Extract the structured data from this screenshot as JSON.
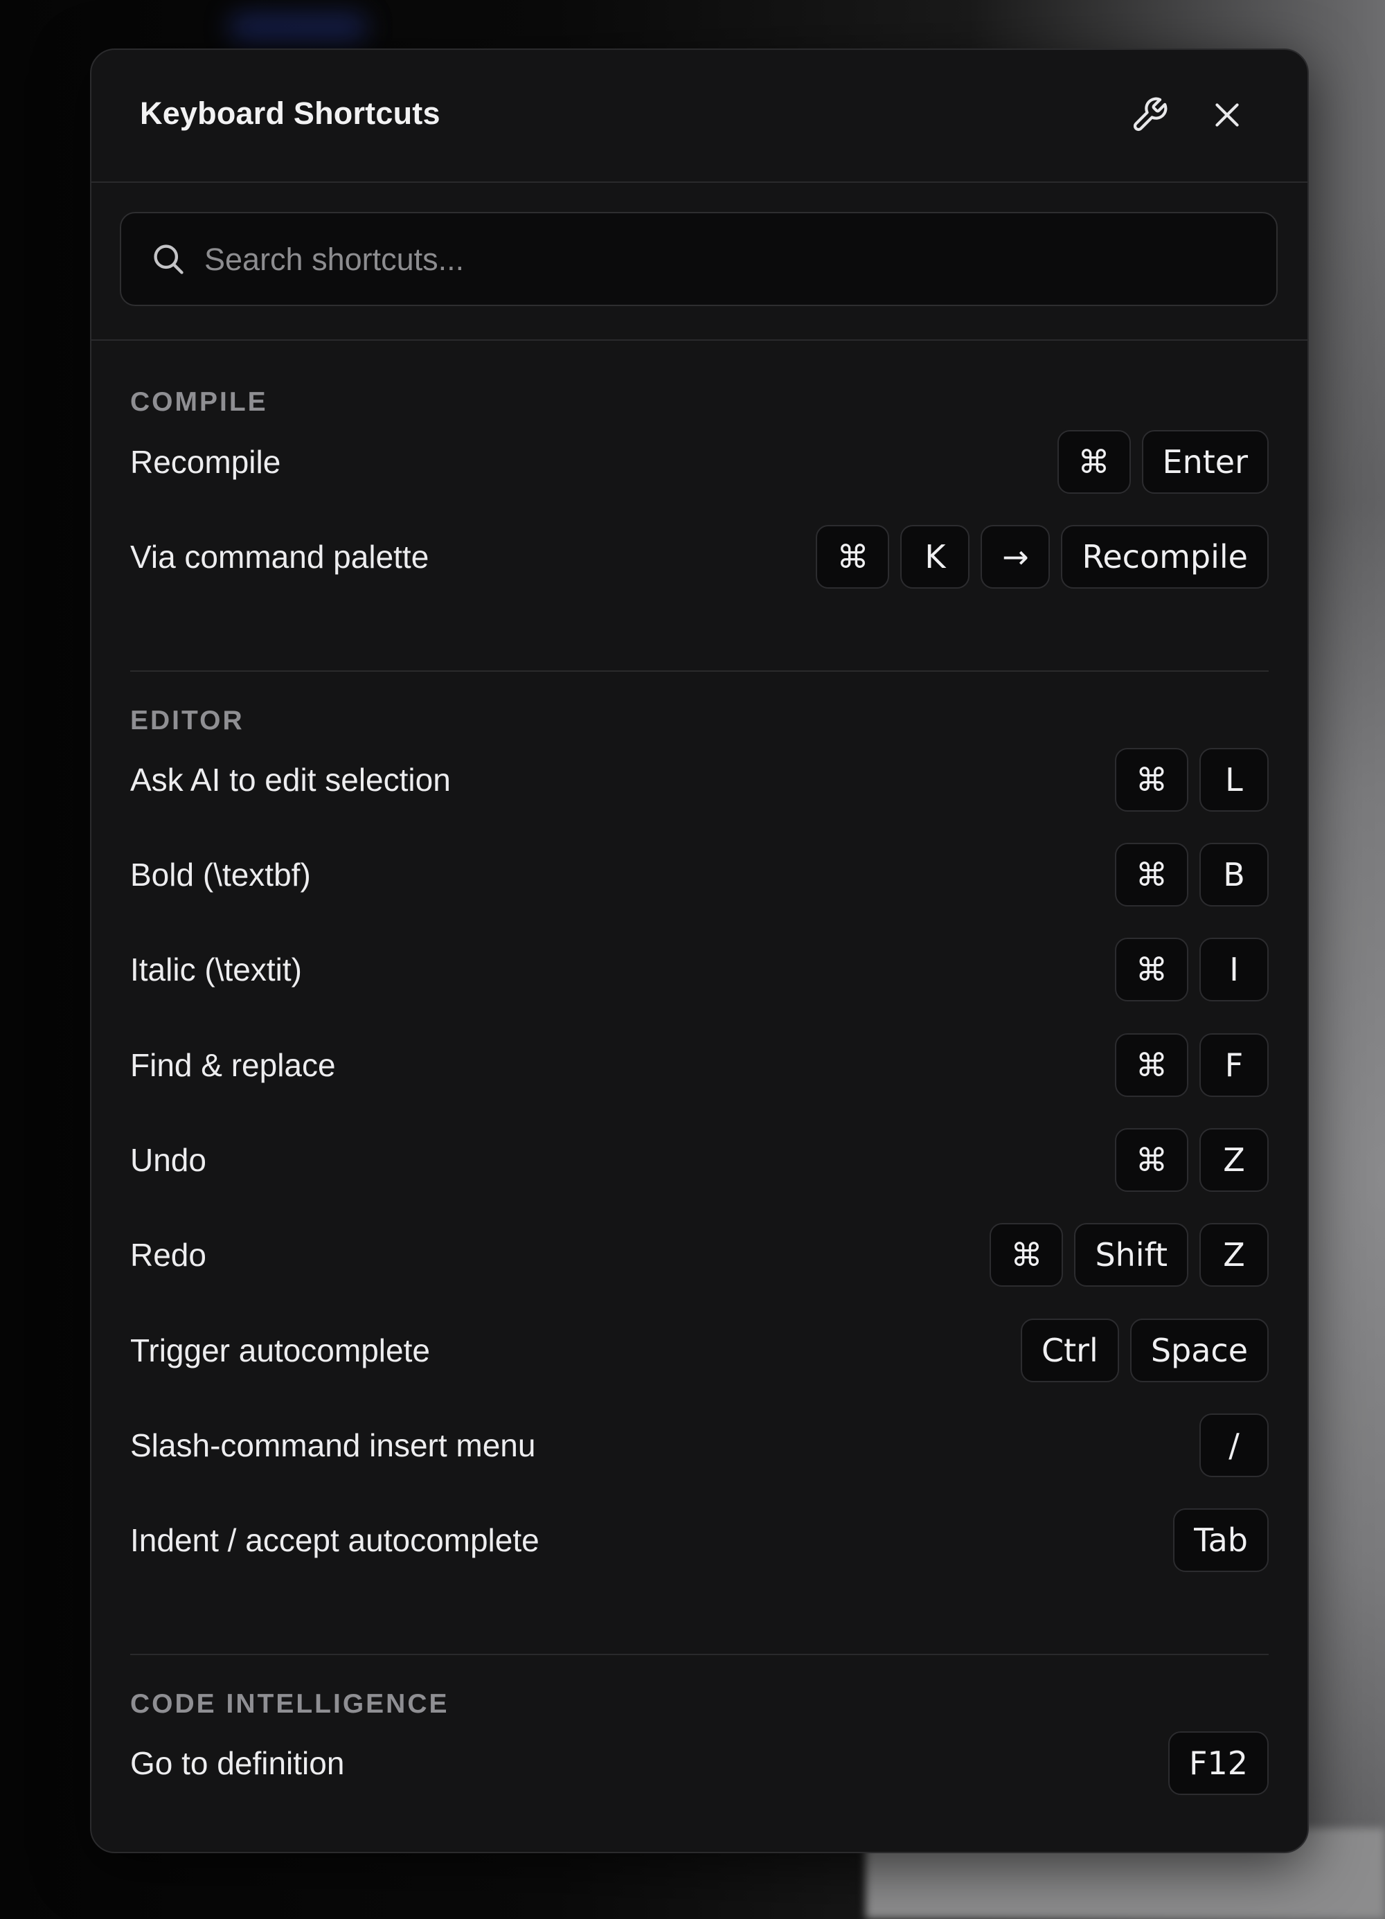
{
  "dialog": {
    "title": "Keyboard Shortcuts",
    "wrench_icon": "wrench-icon",
    "close_icon": "close-icon"
  },
  "search": {
    "placeholder": "Search shortcuts...",
    "value": "",
    "icon": "search-icon"
  },
  "sections": [
    {
      "title": "COMPILE",
      "items": [
        {
          "label": "Recompile",
          "keys": [
            "⌘",
            "Enter"
          ]
        },
        {
          "label": "Via command palette",
          "keys": [
            "⌘",
            "K",
            "→",
            "Recompile"
          ]
        }
      ]
    },
    {
      "title": "EDITOR",
      "items": [
        {
          "label": "Ask AI to edit selection",
          "keys": [
            "⌘",
            "L"
          ]
        },
        {
          "label": "Bold (\\textbf)",
          "keys": [
            "⌘",
            "B"
          ]
        },
        {
          "label": "Italic (\\textit)",
          "keys": [
            "⌘",
            "I"
          ]
        },
        {
          "label": "Find & replace",
          "keys": [
            "⌘",
            "F"
          ]
        },
        {
          "label": "Undo",
          "keys": [
            "⌘",
            "Z"
          ]
        },
        {
          "label": "Redo",
          "keys": [
            "⌘",
            "Shift",
            "Z"
          ]
        },
        {
          "label": "Trigger autocomplete",
          "keys": [
            "Ctrl",
            "Space"
          ]
        },
        {
          "label": "Slash-command insert menu",
          "keys": [
            "/"
          ]
        },
        {
          "label": "Indent / accept autocomplete",
          "keys": [
            "Tab"
          ]
        }
      ]
    },
    {
      "title": "CODE INTELLIGENCE",
      "items": [
        {
          "label": "Go to definition",
          "keys": [
            "F12"
          ]
        }
      ]
    }
  ]
}
